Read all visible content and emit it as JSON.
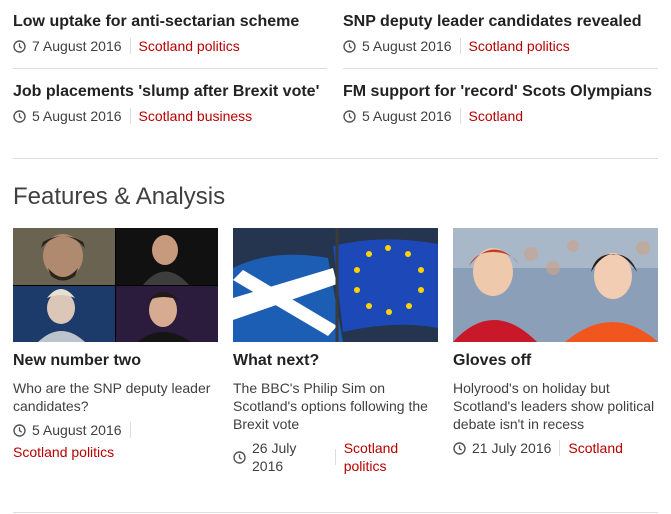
{
  "top_stories": [
    {
      "title": "Low uptake for anti-sectarian scheme",
      "date": "7 August 2016",
      "tag": "Scotland politics"
    },
    {
      "title": "SNP deputy leader candidates revealed",
      "date": "5 August 2016",
      "tag": "Scotland politics"
    },
    {
      "title": "Job placements 'slump after Brexit vote'",
      "date": "5 August 2016",
      "tag": "Scotland business"
    },
    {
      "title": "FM support for 'record' Scots Olympians",
      "date": "5 August 2016",
      "tag": "Scotland"
    }
  ],
  "features": {
    "heading": "Features & Analysis",
    "cards": [
      {
        "title": "New number two",
        "summary": "Who are the SNP deputy leader candidates?",
        "date": "5 August 2016",
        "tag": "Scotland politics"
      },
      {
        "title": "What next?",
        "summary": "The BBC's Philip Sim on Scotland's options following the Brexit vote",
        "date": "26 July 2016",
        "tag": "Scotland politics"
      },
      {
        "title": "Gloves off",
        "summary": "Holyrood's on holiday but Scotland's leaders show political debate isn't in recess",
        "date": "21 July 2016",
        "tag": "Scotland"
      }
    ]
  },
  "colors": {
    "tag": "#b80000",
    "text": "#222222",
    "muted": "#404040",
    "rule": "#dddddd"
  },
  "icons": {
    "timestamp": "clock-icon"
  }
}
